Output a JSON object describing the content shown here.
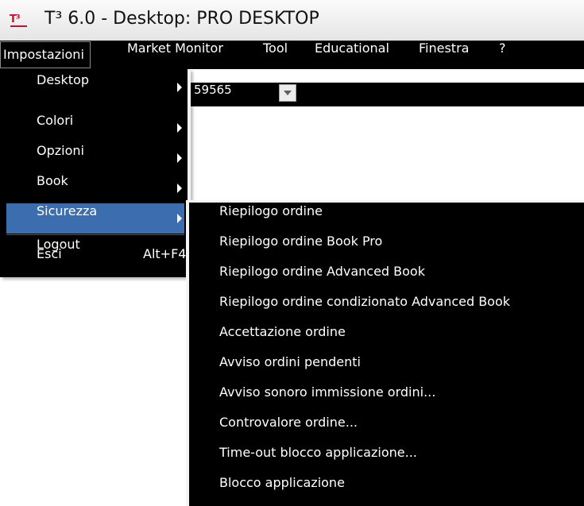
{
  "window": {
    "logo_text": "T³",
    "title": "T³ 6.0 - Desktop: PRO DESKTOP"
  },
  "menubar": {
    "items": [
      {
        "label": "Impostazioni"
      },
      {
        "label": "Market Monitor"
      },
      {
        "label": "Tool"
      },
      {
        "label": "Educational"
      },
      {
        "label": "Finestra"
      },
      {
        "label": "?"
      }
    ]
  },
  "background": {
    "combo_value": "59565"
  },
  "dropdown": {
    "items": [
      {
        "label": "Desktop",
        "submenu": true
      },
      {
        "label": "Colori",
        "submenu": true
      },
      {
        "label": "Opzioni",
        "submenu": true
      },
      {
        "label": "Book",
        "submenu": true
      },
      {
        "label": "Sicurezza",
        "submenu": true,
        "highlighted": true
      },
      {
        "label": "Logout"
      },
      {
        "label": "Esci",
        "shortcut": "Alt+F4"
      }
    ]
  },
  "submenu": {
    "items": [
      {
        "label": "Riepilogo ordine"
      },
      {
        "label": "Riepilogo ordine Book Pro"
      },
      {
        "label": "Riepilogo ordine Advanced Book"
      },
      {
        "label": "Riepilogo ordine condizionato Advanced Book"
      },
      {
        "label": "Accettazione ordine"
      },
      {
        "label": "Avviso ordini pendenti"
      },
      {
        "label": "Avviso sonoro immissione ordini..."
      },
      {
        "label": "Controvalore ordine..."
      },
      {
        "label": "Time-out blocco applicazione..."
      },
      {
        "label": "Blocco applicazione"
      }
    ]
  },
  "colors": {
    "menu_background": "#000000",
    "menu_text": "#ffffff",
    "highlight": "#3c6eaf",
    "logo": "#c8102e"
  },
  "icons": {
    "app_logo": "t3-logo-icon",
    "submenu_arrow": "submenu-arrow-icon",
    "combo_arrow": "chevron-down-icon"
  }
}
